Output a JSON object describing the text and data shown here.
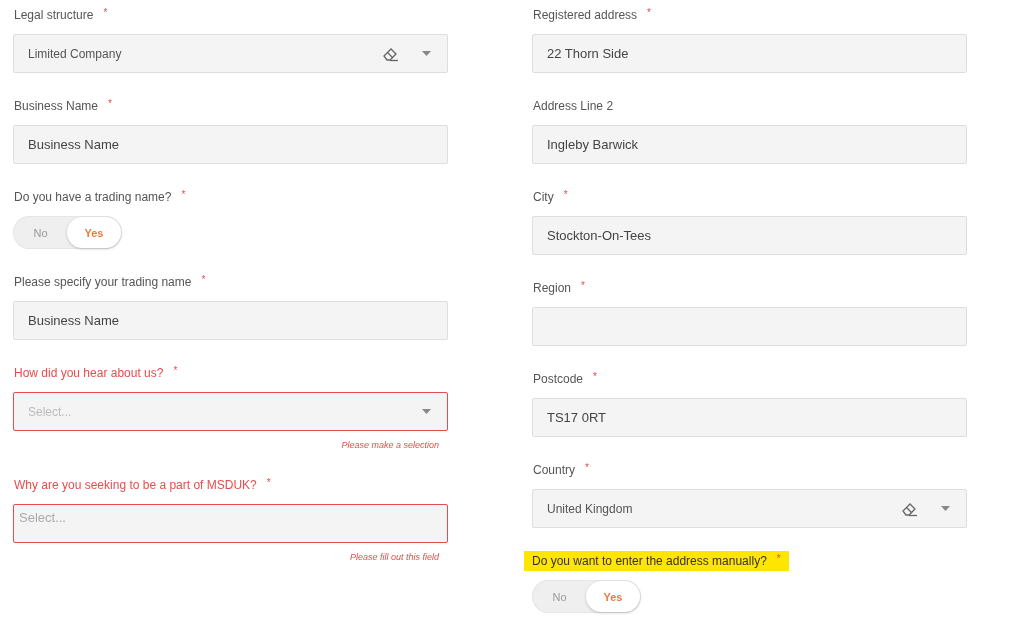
{
  "left_column": [
    {
      "kind": "select",
      "label": "Legal structure",
      "required_mark": "*",
      "value": "Limited Company",
      "clearable": true,
      "error": false,
      "highlighted": false
    },
    {
      "kind": "input",
      "label": "Business Name",
      "required_mark": "*",
      "value": "Business Name",
      "error": false,
      "highlighted": false
    },
    {
      "kind": "toggle",
      "label": "Do you have a trading name?",
      "required_mark": "*",
      "error": false,
      "highlighted": false,
      "options": [
        {
          "label": "No",
          "selected": false
        },
        {
          "label": "Yes",
          "selected": true
        }
      ]
    },
    {
      "kind": "input",
      "label": "Please specify your trading name",
      "required_mark": "*",
      "value": "Business Name",
      "error": false,
      "highlighted": false
    },
    {
      "kind": "select",
      "label": "How did you hear about us?",
      "required_mark": "*",
      "placeholder": "Select...",
      "clearable": false,
      "error": true,
      "error_message": "Please make a selection",
      "highlighted": false
    },
    {
      "kind": "multiselect",
      "label": "Why are you seeking to be a part of MSDUK?",
      "required_mark": "*",
      "placeholder": "Select...",
      "error": true,
      "error_message": "Please fill out this field",
      "highlighted": false
    }
  ],
  "right_column": [
    {
      "kind": "input",
      "label": "Registered address",
      "required_mark": "*",
      "value": "22 Thorn Side",
      "error": false,
      "highlighted": false
    },
    {
      "kind": "input",
      "label": "Address Line 2",
      "value": "Ingleby Barwick",
      "error": false,
      "highlighted": false
    },
    {
      "kind": "input",
      "label": "City",
      "required_mark": "*",
      "value": "Stockton-On-Tees",
      "error": false,
      "highlighted": false
    },
    {
      "kind": "input",
      "label": "Region",
      "required_mark": "*",
      "error": false,
      "highlighted": false
    },
    {
      "kind": "input",
      "label": "Postcode",
      "required_mark": "*",
      "value": "TS17 0RT",
      "error": false,
      "highlighted": false
    },
    {
      "kind": "select",
      "label": "Country",
      "required_mark": "*",
      "value": "United Kingdom",
      "clearable": true,
      "error": false,
      "highlighted": false
    },
    {
      "kind": "toggle",
      "label": "Do you want to enter the address manually?",
      "required_mark": "*",
      "error": false,
      "highlighted": true,
      "options": [
        {
          "label": "No",
          "selected": false
        },
        {
          "label": "Yes",
          "selected": true
        }
      ]
    }
  ]
}
